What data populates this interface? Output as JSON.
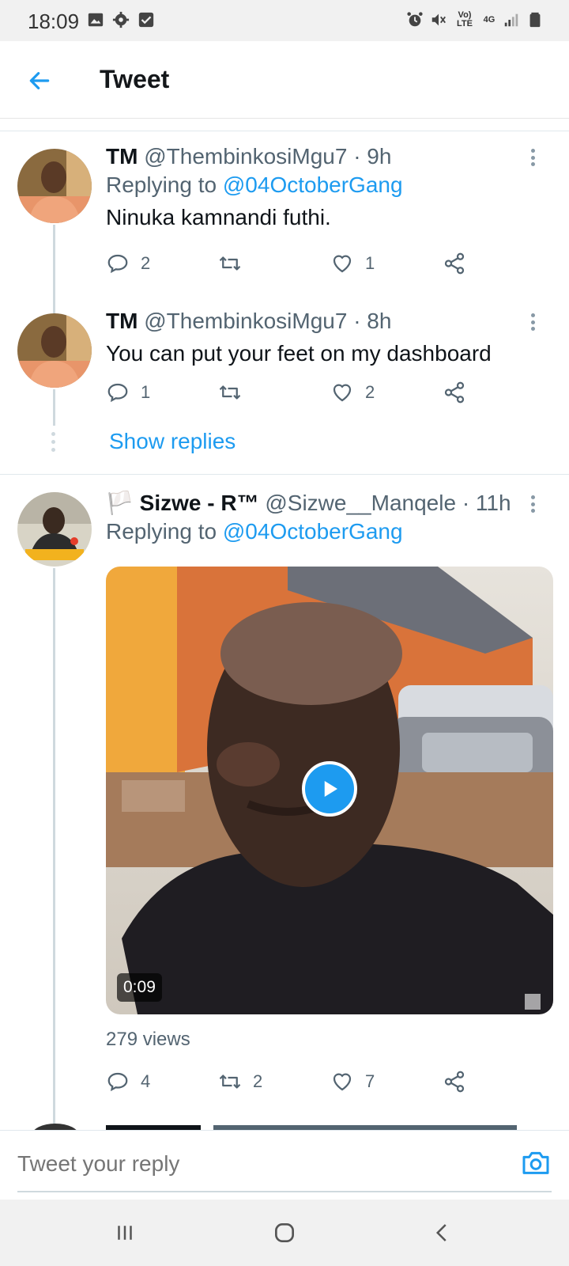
{
  "status_bar": {
    "time": "18:09",
    "left_icons": [
      "gallery-icon",
      "settings-icon",
      "check-box-icon"
    ],
    "right_icons": [
      "alarm-icon",
      "mute-icon",
      "volte-icon",
      "4g-icon",
      "signal-icon",
      "battery-icon"
    ],
    "volte_label": "Vo) LTE",
    "network_label": "4G"
  },
  "header": {
    "title": "Tweet"
  },
  "tweets": [
    {
      "name": "TM",
      "handle": "@ThembinkosiMgu7",
      "time": "· 9h",
      "replying_prefix": "Replying to ",
      "replying_to": "@04OctoberGang",
      "text": "Ninuka kamnandi futhi.",
      "replies": "2",
      "retweets": "",
      "likes": "1"
    },
    {
      "name": "TM",
      "handle": "@ThembinkosiMgu7",
      "time": "· 8h",
      "text": "You can put your feet on my dashboard",
      "replies": "1",
      "retweets": "",
      "likes": "2",
      "show_replies": "Show replies"
    },
    {
      "name_flag": "🏳️",
      "name": "Sizwe - R™",
      "handle": "@Sizwe__Manqele",
      "time": "· 11h",
      "replying_prefix": "Replying to ",
      "replying_to": "@04OctoberGang",
      "media": {
        "type": "video",
        "duration": "0:09"
      },
      "views": "279 views",
      "replies": "4",
      "retweets": "2",
      "likes": "7"
    }
  ],
  "reply_bar": {
    "placeholder": "Tweet your reply"
  },
  "nav_bar": {
    "buttons": [
      "recent-apps",
      "home",
      "back"
    ]
  },
  "colors": {
    "accent": "#1d9bf0",
    "text_primary": "#0f1419",
    "text_secondary": "#536471",
    "divider": "#e1e8ed"
  }
}
